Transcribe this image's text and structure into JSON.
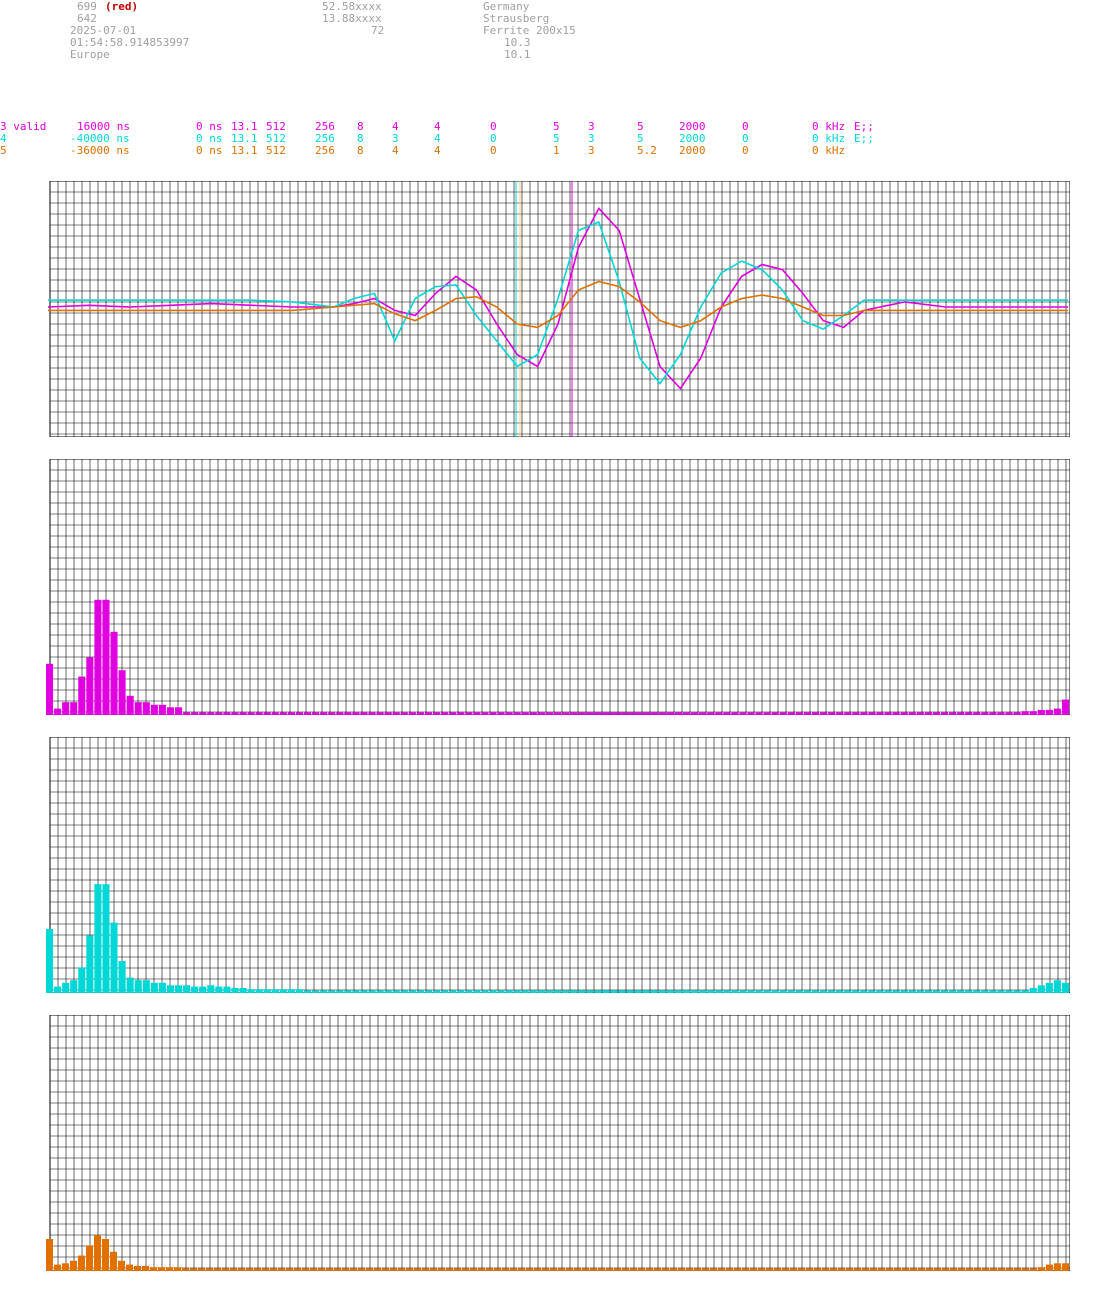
{
  "header": {
    "col1": {
      "count": "699",
      "count_note": "(red)",
      "sub_count": "642",
      "date": "2025-07-01",
      "time": "01:54:58.914853997",
      "region": "Europe"
    },
    "col2": {
      "lat": "52.58xxxx",
      "lon": "13.88xxxx",
      "alt": "72"
    },
    "col3": {
      "country": "Germany",
      "city": "Strausberg",
      "antenna": "Ferrite 200x15",
      "v1": "10.3",
      "v2": "10.1"
    }
  },
  "channels": [
    {
      "id": "3 valid",
      "offset": "16000 ns",
      "c3": "0 ns",
      "c4": "13.1",
      "c5": "512",
      "c6": "256",
      "c7": "8",
      "c8": "4",
      "c9": "4",
      "c10": "0",
      "c11": "5",
      "c12": "3",
      "c13": "5",
      "c14": "2000",
      "c15": "0",
      "c16": "0 kHz",
      "c17": "E;;",
      "color": "#e000e0"
    },
    {
      "id": "4",
      "offset": "-40000 ns",
      "c3": "0 ns",
      "c4": "13.1",
      "c5": "512",
      "c6": "256",
      "c7": "8",
      "c8": "3",
      "c9": "4",
      "c10": "0",
      "c11": "5",
      "c12": "3",
      "c13": "5",
      "c14": "2000",
      "c15": "0",
      "c16": "0 kHz",
      "c17": "E;;",
      "color": "#00d8d8"
    },
    {
      "id": "5",
      "offset": "-36000 ns",
      "c3": "0 ns",
      "c4": "13.1",
      "c5": "512",
      "c6": "256",
      "c7": "8",
      "c8": "4",
      "c9": "4",
      "c10": "0",
      "c11": "1",
      "c12": "3",
      "c13": "5.2",
      "c14": "2000",
      "c15": "0",
      "c16": "0 kHz",
      "c17": "",
      "color": "#e07000"
    }
  ],
  "chart_data": [
    {
      "type": "line",
      "description": "time-domain waveforms, three channels",
      "ylim": [
        -1,
        1
      ],
      "x": [
        0,
        0.04,
        0.08,
        0.12,
        0.16,
        0.2,
        0.24,
        0.28,
        0.3,
        0.32,
        0.34,
        0.36,
        0.38,
        0.4,
        0.42,
        0.44,
        0.46,
        0.48,
        0.5,
        0.52,
        0.54,
        0.56,
        0.58,
        0.6,
        0.62,
        0.64,
        0.66,
        0.68,
        0.7,
        0.72,
        0.74,
        0.76,
        0.78,
        0.8,
        0.84,
        0.88,
        0.92,
        0.96,
        1.0
      ],
      "series": [
        {
          "values": [
            0,
            0.01,
            0.0,
            0.01,
            0.02,
            0.01,
            0.0,
            0.0,
            0.02,
            0.05,
            -0.02,
            -0.05,
            0.08,
            0.18,
            0.1,
            -0.1,
            -0.28,
            -0.35,
            -0.1,
            0.35,
            0.58,
            0.45,
            0.05,
            -0.35,
            -0.48,
            -0.3,
            0.0,
            0.18,
            0.25,
            0.22,
            0.08,
            -0.08,
            -0.12,
            -0.02,
            0.03,
            0.0,
            0.0,
            0.0,
            0.0
          ],
          "color": "#e000e0"
        },
        {
          "values": [
            0.04,
            0.04,
            0.04,
            0.04,
            0.04,
            0.04,
            0.03,
            0.0,
            0.05,
            0.08,
            -0.2,
            0.05,
            0.12,
            0.13,
            -0.05,
            -0.2,
            -0.35,
            -0.28,
            0.05,
            0.45,
            0.5,
            0.15,
            -0.3,
            -0.45,
            -0.28,
            0.0,
            0.2,
            0.27,
            0.22,
            0.1,
            -0.08,
            -0.13,
            -0.05,
            0.04,
            0.04,
            0.04,
            0.04,
            0.04,
            0.04
          ],
          "color": "#00d8d8"
        },
        {
          "values": [
            -0.02,
            -0.02,
            -0.02,
            -0.02,
            -0.02,
            -0.02,
            -0.02,
            0.0,
            0.01,
            0.02,
            -0.04,
            -0.08,
            -0.02,
            0.05,
            0.06,
            0.0,
            -0.1,
            -0.12,
            -0.05,
            0.1,
            0.15,
            0.12,
            0.03,
            -0.08,
            -0.12,
            -0.08,
            0.0,
            0.05,
            0.07,
            0.05,
            0.0,
            -0.05,
            -0.05,
            -0.02,
            -0.02,
            -0.02,
            -0.02,
            -0.02,
            -0.02
          ],
          "color": "#e07000"
        }
      ]
    },
    {
      "type": "bar",
      "description": "spectrum channel 3",
      "color": "#e000e0",
      "ylim": [
        0,
        1
      ],
      "values": [
        0.4,
        0.05,
        0.1,
        0.1,
        0.3,
        0.45,
        0.9,
        0.9,
        0.65,
        0.35,
        0.15,
        0.1,
        0.1,
        0.08,
        0.08,
        0.06,
        0.06,
        0.02,
        0.02,
        0.02,
        0.02,
        0.02,
        0.02,
        0.02,
        0.02,
        0.02,
        0.02,
        0.02,
        0.02,
        0.02,
        0.02,
        0.02,
        0.02,
        0.02,
        0.02,
        0.02,
        0.02,
        0.02,
        0.02,
        0.02,
        0.02,
        0.02,
        0.02,
        0.02,
        0.02,
        0.02,
        0.02,
        0.02,
        0.02,
        0.02,
        0.02,
        0.02,
        0.02,
        0.02,
        0.02,
        0.02,
        0.02,
        0.02,
        0.02,
        0.02,
        0.02,
        0.02,
        0.02,
        0.02,
        0.02,
        0.02,
        0.02,
        0.02,
        0.02,
        0.02,
        0.02,
        0.02,
        0.02,
        0.02,
        0.02,
        0.02,
        0.02,
        0.02,
        0.02,
        0.02,
        0.02,
        0.02,
        0.02,
        0.02,
        0.02,
        0.02,
        0.02,
        0.02,
        0.02,
        0.02,
        0.02,
        0.02,
        0.02,
        0.02,
        0.02,
        0.02,
        0.02,
        0.02,
        0.02,
        0.02,
        0.02,
        0.02,
        0.02,
        0.02,
        0.02,
        0.02,
        0.02,
        0.02,
        0.02,
        0.02,
        0.02,
        0.02,
        0.02,
        0.02,
        0.02,
        0.02,
        0.02,
        0.02,
        0.02,
        0.02,
        0.02,
        0.03,
        0.03,
        0.04,
        0.04,
        0.05,
        0.12
      ]
    },
    {
      "type": "bar",
      "description": "spectrum channel 4",
      "color": "#00d8d8",
      "ylim": [
        0,
        1
      ],
      "values": [
        0.5,
        0.05,
        0.08,
        0.1,
        0.2,
        0.45,
        0.85,
        0.85,
        0.55,
        0.25,
        0.12,
        0.1,
        0.1,
        0.08,
        0.08,
        0.06,
        0.06,
        0.06,
        0.05,
        0.05,
        0.06,
        0.05,
        0.05,
        0.04,
        0.04,
        0.03,
        0.03,
        0.03,
        0.03,
        0.03,
        0.03,
        0.03,
        0.02,
        0.02,
        0.02,
        0.02,
        0.02,
        0.02,
        0.02,
        0.02,
        0.02,
        0.02,
        0.02,
        0.02,
        0.02,
        0.02,
        0.02,
        0.02,
        0.02,
        0.02,
        0.02,
        0.02,
        0.02,
        0.02,
        0.02,
        0.02,
        0.02,
        0.02,
        0.02,
        0.02,
        0.02,
        0.02,
        0.02,
        0.02,
        0.02,
        0.02,
        0.02,
        0.02,
        0.02,
        0.02,
        0.02,
        0.02,
        0.02,
        0.02,
        0.02,
        0.02,
        0.02,
        0.02,
        0.02,
        0.02,
        0.02,
        0.02,
        0.02,
        0.02,
        0.02,
        0.02,
        0.02,
        0.02,
        0.02,
        0.02,
        0.02,
        0.02,
        0.02,
        0.02,
        0.02,
        0.02,
        0.02,
        0.02,
        0.02,
        0.02,
        0.02,
        0.02,
        0.02,
        0.02,
        0.02,
        0.02,
        0.02,
        0.02,
        0.02,
        0.02,
        0.02,
        0.02,
        0.02,
        0.02,
        0.02,
        0.02,
        0.02,
        0.02,
        0.02,
        0.02,
        0.02,
        0.02,
        0.04,
        0.06,
        0.08,
        0.1,
        0.08
      ]
    },
    {
      "type": "bar",
      "description": "spectrum channel 5",
      "color": "#e07000",
      "ylim": [
        0,
        1
      ],
      "values": [
        0.25,
        0.05,
        0.06,
        0.08,
        0.12,
        0.2,
        0.28,
        0.25,
        0.15,
        0.08,
        0.05,
        0.04,
        0.04,
        0.03,
        0.03,
        0.03,
        0.03,
        0.02,
        0.02,
        0.02,
        0.02,
        0.02,
        0.02,
        0.02,
        0.02,
        0.02,
        0.02,
        0.02,
        0.02,
        0.02,
        0.02,
        0.02,
        0.02,
        0.02,
        0.02,
        0.02,
        0.02,
        0.02,
        0.02,
        0.02,
        0.02,
        0.02,
        0.02,
        0.02,
        0.02,
        0.02,
        0.02,
        0.02,
        0.02,
        0.02,
        0.02,
        0.02,
        0.02,
        0.02,
        0.02,
        0.02,
        0.02,
        0.02,
        0.02,
        0.02,
        0.02,
        0.02,
        0.02,
        0.02,
        0.02,
        0.02,
        0.02,
        0.02,
        0.02,
        0.02,
        0.02,
        0.02,
        0.02,
        0.02,
        0.02,
        0.02,
        0.02,
        0.02,
        0.02,
        0.02,
        0.02,
        0.02,
        0.02,
        0.02,
        0.02,
        0.02,
        0.02,
        0.02,
        0.02,
        0.02,
        0.02,
        0.02,
        0.02,
        0.02,
        0.02,
        0.02,
        0.02,
        0.02,
        0.02,
        0.02,
        0.02,
        0.02,
        0.02,
        0.02,
        0.02,
        0.02,
        0.02,
        0.02,
        0.02,
        0.02,
        0.02,
        0.02,
        0.02,
        0.02,
        0.02,
        0.02,
        0.02,
        0.02,
        0.02,
        0.02,
        0.02,
        0.02,
        0.02,
        0.02,
        0.03,
        0.05,
        0.06,
        0.06
      ]
    }
  ]
}
